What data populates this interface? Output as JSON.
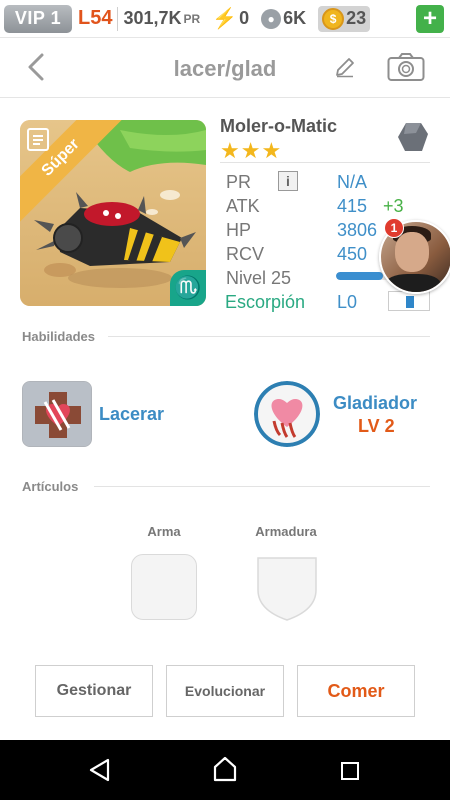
{
  "status_bar": {
    "vip": "VIP 1",
    "level": "L54",
    "points": "301,7K",
    "points_suffix": "PR",
    "energy": "0",
    "pets": "6K",
    "coins": "23",
    "add_label": "+"
  },
  "header": {
    "title": "lacer/glad"
  },
  "pet": {
    "ribbon": "Súper",
    "name": "Moler-o-Matic",
    "stars": "★★★",
    "zodiac_symbol": "♏",
    "stats": [
      {
        "label": "PR",
        "value": "N/A"
      },
      {
        "label": "ATK",
        "value": "415",
        "bonus": "+3"
      },
      {
        "label": "HP",
        "value": "3806"
      },
      {
        "label": "RCV",
        "value": "450"
      }
    ],
    "info_label": "i",
    "level_label": "Nivel 25",
    "xp_fraction": 0.5,
    "sign": "Escorpión",
    "sign_level": "L0"
  },
  "notification": {
    "count": "1"
  },
  "skills": {
    "section_label": "Habilidades",
    "items": [
      {
        "name": "Lacerar"
      },
      {
        "name": "Gladiador",
        "level": "LV 2"
      }
    ]
  },
  "items": {
    "section_label": "Artículos",
    "slots": [
      {
        "label": "Arma"
      },
      {
        "label": "Armadura"
      }
    ]
  },
  "actions": {
    "manage": "Gestionar",
    "evolve": "Evolucionar",
    "eat": "Comer"
  },
  "colors": {
    "accent_blue": "#3f8fc8",
    "accent_orange": "#e25a18",
    "green": "#48b147"
  }
}
